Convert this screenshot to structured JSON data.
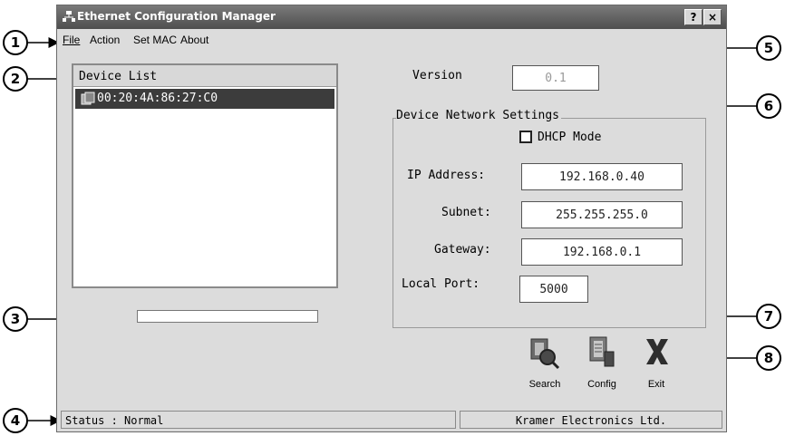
{
  "window": {
    "title": "Ethernet Configuration Manager",
    "help_button": "?",
    "close_button": "×"
  },
  "menu": {
    "items": [
      {
        "label": "File"
      },
      {
        "label": "Action"
      },
      {
        "label": "Set MAC"
      },
      {
        "label": "About"
      }
    ]
  },
  "device_list": {
    "header": "Device List",
    "devices": [
      "00:20:4A:86:27:C0"
    ]
  },
  "version": {
    "label": "Version",
    "value": "0.1"
  },
  "network_settings": {
    "group_label": "Device Network Settings",
    "dhcp_label": "DHCP Mode",
    "dhcp_checked": false,
    "ip_label": "IP Address:",
    "ip_value": "192.168.0.40",
    "subnet_label": "Subnet:",
    "subnet_value": "255.255.255.0",
    "gateway_label": "Gateway:",
    "gateway_value": "192.168.0.1",
    "port_label": "Local Port:",
    "port_value": "5000"
  },
  "actions": {
    "search": "Search",
    "config": "Config",
    "exit": "Exit"
  },
  "status": {
    "left": "Status : Normal",
    "right": "Kramer Electronics Ltd."
  },
  "callouts": [
    "1",
    "2",
    "3",
    "4",
    "5",
    "6",
    "7",
    "8"
  ],
  "colors": {
    "titlebar": "#5a5a5a",
    "selection": "#3c3c3c",
    "window_bg": "#dcdcdc"
  }
}
